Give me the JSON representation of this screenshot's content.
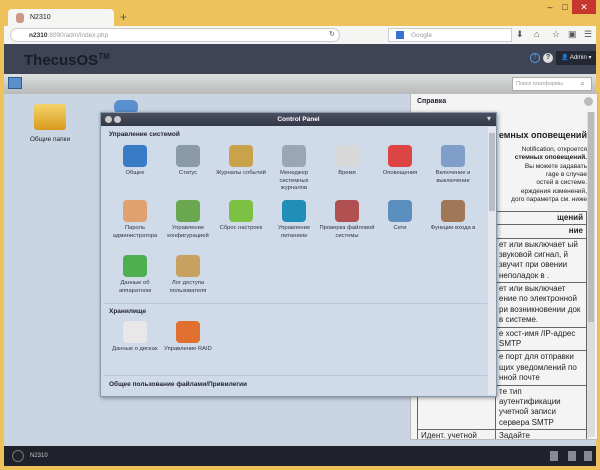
{
  "browser": {
    "tab_title": "N2310",
    "new_tab": "+",
    "url_host": "n2310",
    "url_rest": ":8090/adm/index.php",
    "search_placeholder": "Google",
    "window_controls": [
      "–",
      "□",
      "✕"
    ]
  },
  "header": {
    "logo": "ThecusOS",
    "tm": "TM",
    "user": "Admin"
  },
  "toolbar": {
    "search_placeholder": "Поиск платформы"
  },
  "desktop": {
    "icons": [
      {
        "label": "Общие папки"
      }
    ]
  },
  "control_panel": {
    "title": "Control Panel",
    "sections": [
      {
        "title": "Управление системой",
        "items": [
          "Общее",
          "Статус",
          "Журналы событий",
          "Менеджер системных журналов",
          "Время",
          "Оповещения",
          "Включение и выключение",
          "Пароль администратора",
          "Управление конфигурацией",
          "Сброс настроек",
          "Управление питанием",
          "Проверка файловой системы",
          "Сети",
          "Функции входа в",
          "Данные об аппаратном",
          "Лог доступа пользователя"
        ]
      },
      {
        "title": "Хранилище",
        "items": [
          "Данные о дисках",
          "Управление RAID"
        ]
      },
      {
        "title": "Общее пользование файлами/Привилегии",
        "items": []
      }
    ]
  },
  "help": {
    "title": "Справка",
    "heading": "емных оповещений",
    "lines": [
      "Notification, откроется",
      "стемных оповещений.",
      "Вы можете задавать",
      "rage в случае",
      "остей в системе.",
      "ерждения изменений,",
      "дого параметра см. ниже"
    ],
    "table_header": "щений",
    "table_subheader": "ние",
    "rows": [
      [
        "",
        "ет или выключает ый звуковой сигнал, й звучит при овении неполадок в ."
      ],
      [
        "",
        "ет или выключает ение по электронной ри возникновении док в системе."
      ],
      [
        "",
        "е хост-имя /IP-адрес SMTP"
      ],
      [
        "",
        "е порт для отправки щих уведомлений по нной почте"
      ],
      [
        "",
        "те тип аутентификации учетной записи сервера SMTP"
      ],
      [
        "Идент. учетной записи SMTP",
        "Задайте идентификационное имя учетной записи электронной почты"
      ]
    ]
  },
  "taskbar": {
    "label": "N2310"
  }
}
